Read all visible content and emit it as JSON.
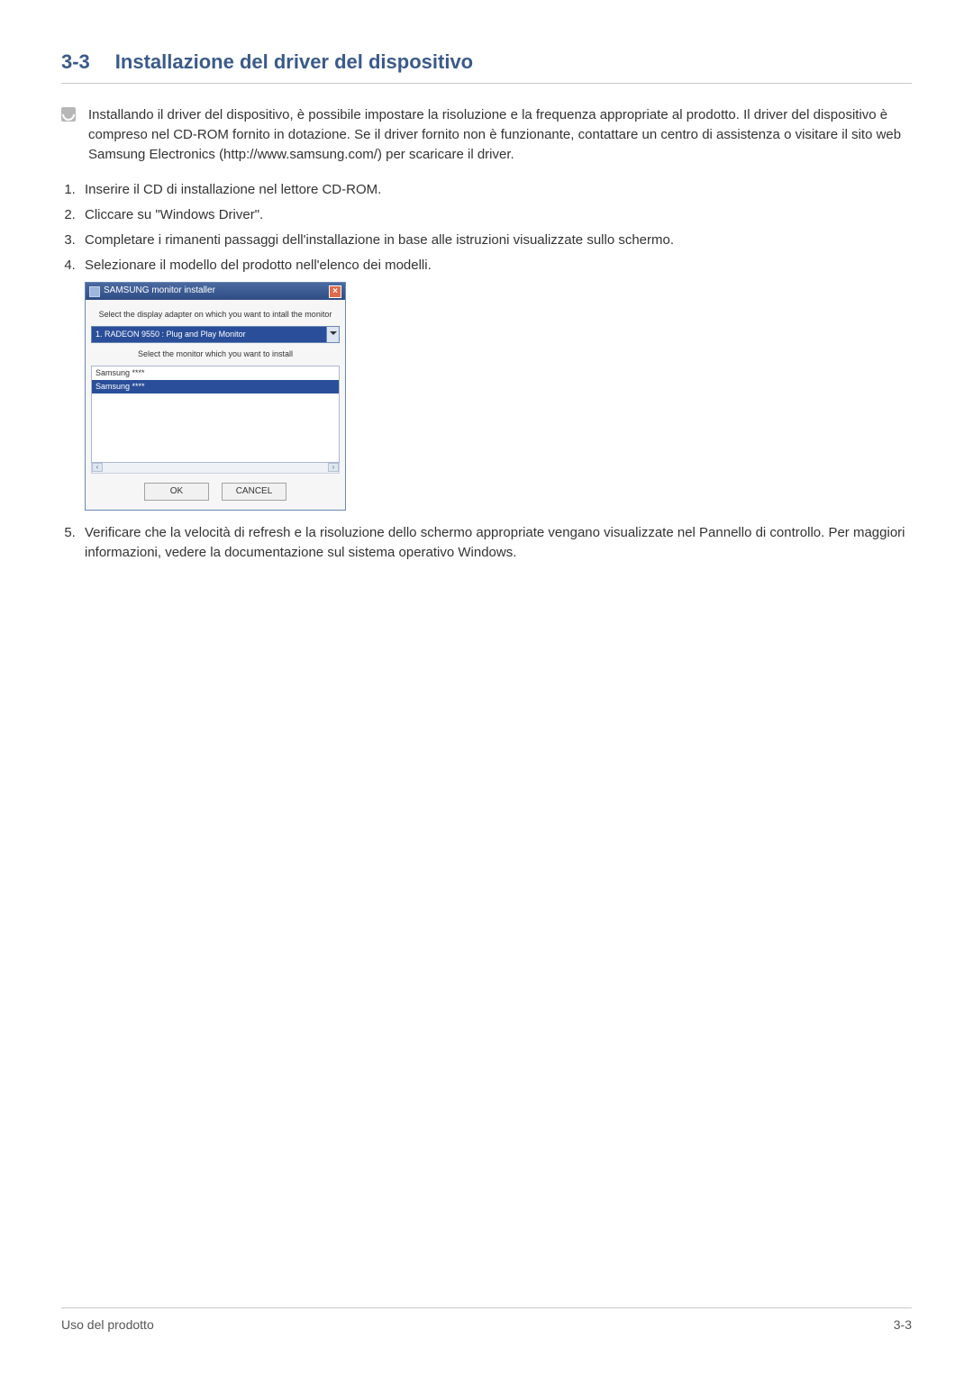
{
  "header": {
    "section_number": "3-3",
    "title": "Installazione del driver del dispositivo"
  },
  "note": {
    "text": "Installando il driver del dispositivo, è possibile impostare la risoluzione e la frequenza appropriate al prodotto. Il driver del dispositivo è compreso nel CD-ROM fornito in dotazione. Se il driver fornito non è funzionante, contattare un centro di assistenza o visitare il sito web Samsung Electronics (http://www.samsung.com/) per scaricare il driver."
  },
  "steps": {
    "1": "Inserire il CD di installazione nel lettore CD-ROM.",
    "2": "Cliccare su \"Windows Driver\".",
    "3": "Completare i rimanenti passaggi dell'installazione in base alle istruzioni visualizzate sullo schermo.",
    "4": "Selezionare il modello del prodotto nell'elenco dei modelli.",
    "5": "Verificare che la velocità di refresh e la risoluzione dello schermo appropriate vengano visualizzate nel Pannello di controllo. Per maggiori informazioni, vedere la documentazione sul sistema operativo Windows."
  },
  "installer": {
    "title": "SAMSUNG monitor installer",
    "close": "×",
    "instr1": "Select the display adapter on which you want to intall the monitor",
    "adapter_value": "1. RADEON 9550 : Plug and Play Monitor",
    "instr2": "Select the monitor which you want to install",
    "list_item1": "Samsung ****",
    "list_item2": "Samsung ****",
    "scroll_left": "‹",
    "scroll_right": "›",
    "ok": "OK",
    "cancel": "CANCEL"
  },
  "footer": {
    "left": "Uso del prodotto",
    "right": "3-3"
  }
}
